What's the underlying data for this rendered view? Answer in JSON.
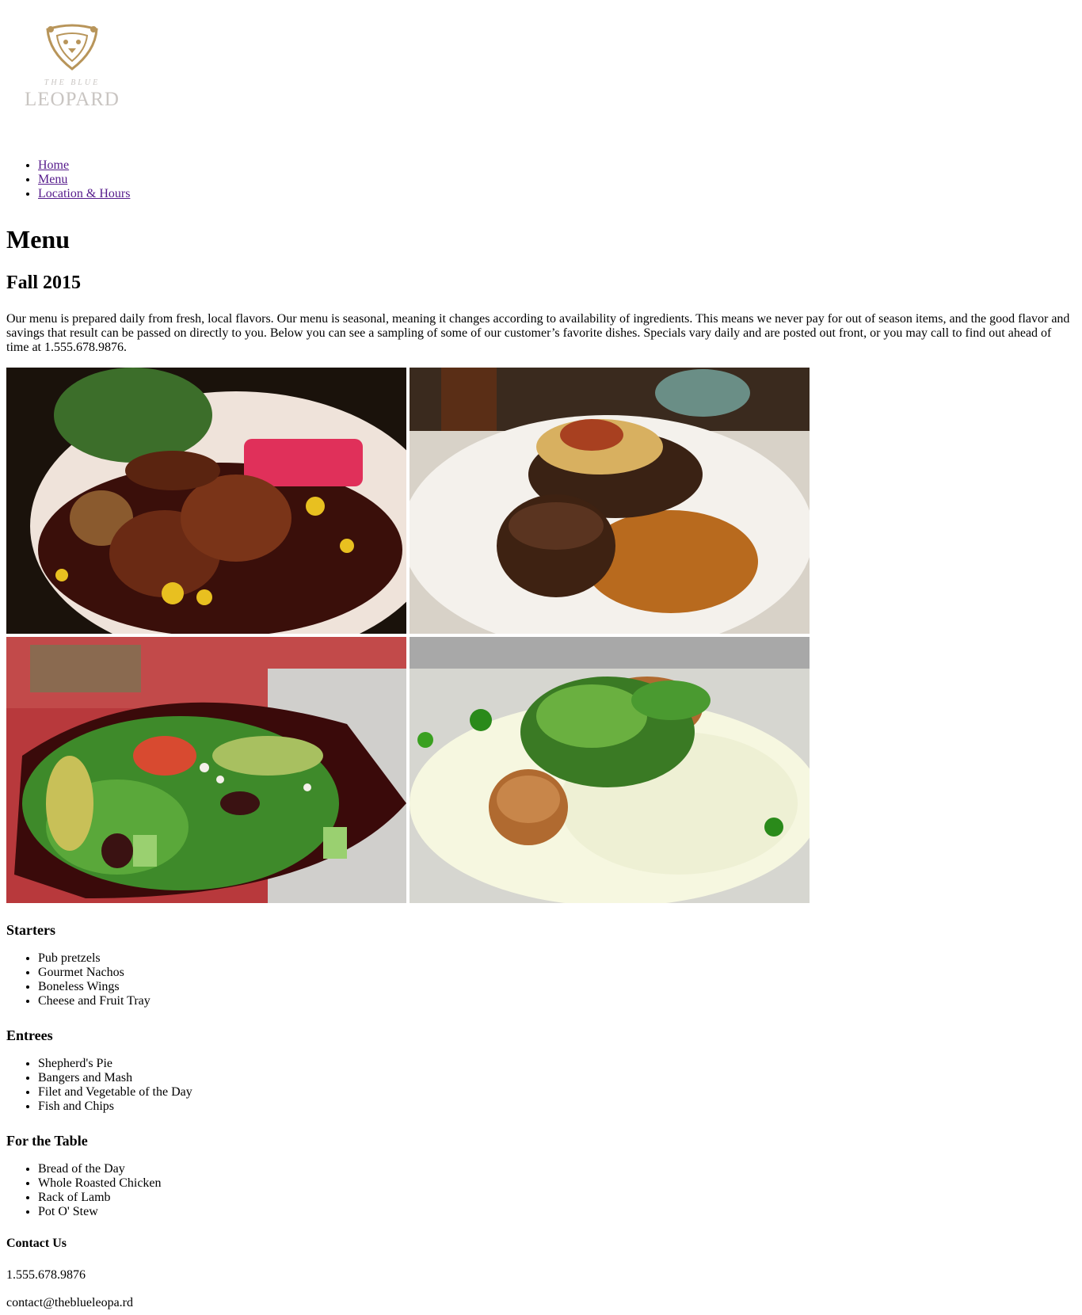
{
  "brand": {
    "logo_small": "THE BLUE",
    "logo_big": "LEOPARD",
    "gold": "#b8955a",
    "grey": "#c9c5c2"
  },
  "nav": [
    {
      "label": "Home"
    },
    {
      "label": "Menu"
    },
    {
      "label": "Location & Hours"
    }
  ],
  "page": {
    "title": "Menu",
    "subtitle": "Fall 2015",
    "intro": "Our menu is prepared daily from fresh, local flavors. Our menu is seasonal, meaning it changes according to availability of ingredients. This means we never pay for out of season items, and the good flavor and savings that result can be passed on directly to you. Below you can see a sampling of some of our customer’s favorite dishes. Specials vary daily and are posted out front, or you may call to find out ahead of time at 1.555.678.9876."
  },
  "gallery": [
    {
      "icon": "lamb-dish-photo"
    },
    {
      "icon": "steak-and-potato-photo"
    },
    {
      "icon": "salad-photo"
    },
    {
      "icon": "scallops-photo"
    }
  ],
  "sections": [
    {
      "heading": "Starters",
      "items": [
        "Pub pretzels",
        "Gourmet Nachos",
        "Boneless Wings",
        "Cheese and Fruit Tray"
      ]
    },
    {
      "heading": "Entrees",
      "items": [
        "Shepherd's Pie",
        "Bangers and Mash",
        "Filet and Vegetable of the Day",
        "Fish and Chips"
      ]
    },
    {
      "heading": "For the Table",
      "items": [
        "Bread of the Day",
        "Whole Roasted Chicken",
        "Rack of Lamb",
        "Pot O' Stew"
      ]
    }
  ],
  "contact": {
    "heading": "Contact Us",
    "phone": "1.555.678.9876",
    "email": "contact@theblueleopa.rd"
  }
}
